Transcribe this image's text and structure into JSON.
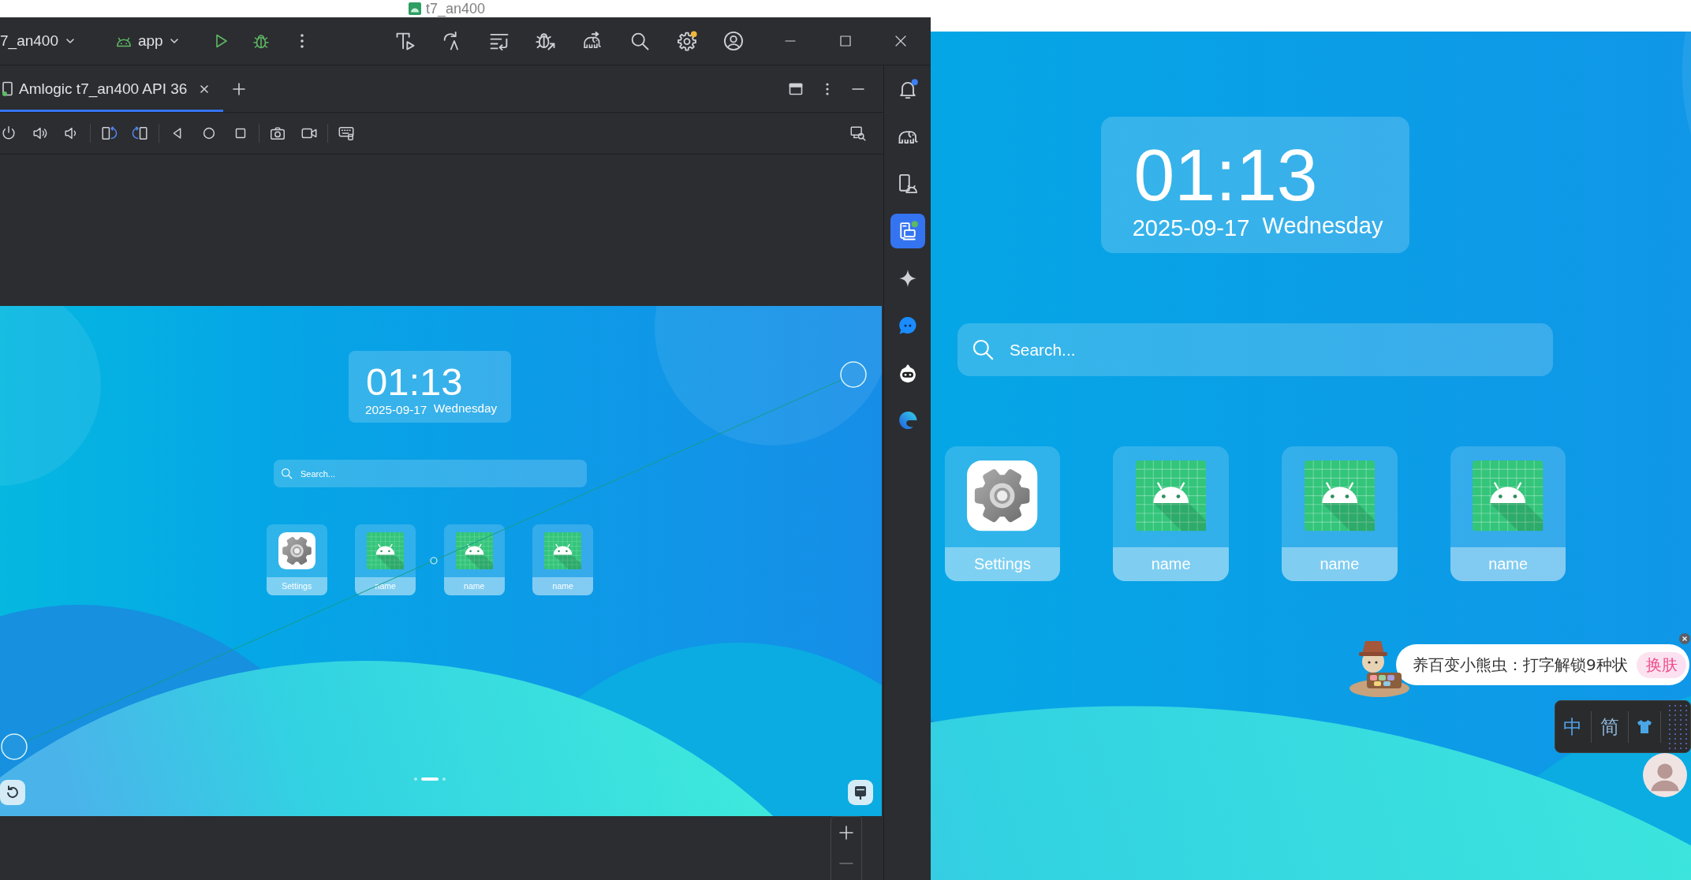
{
  "background_window": {
    "title": "t7_an400"
  },
  "ide": {
    "project": "7_an400",
    "run_configuration": "app",
    "tabs": [
      {
        "label": "Amlogic t7_an400 API 36",
        "selected": true
      }
    ],
    "sidebar": [
      {
        "kind": "bell",
        "selected": false
      },
      {
        "kind": "elephant",
        "selected": false
      },
      {
        "kind": "phone",
        "selected": false
      },
      {
        "kind": "mirror",
        "selected": true
      },
      {
        "kind": "sparkle",
        "selected": false
      },
      {
        "kind": "chat",
        "selected": false
      },
      {
        "kind": "robot",
        "selected": false
      },
      {
        "kind": "swirl",
        "selected": false
      }
    ]
  },
  "emulator_screen": {
    "clock": {
      "time": "01:13",
      "date": "2025-09-17",
      "weekday": "Wednesday"
    },
    "search": {
      "placeholder": "Search..."
    },
    "apps": [
      {
        "kind": "settings",
        "label": "Settings"
      },
      {
        "kind": "android",
        "label": "name"
      },
      {
        "kind": "android",
        "label": "name"
      },
      {
        "kind": "android",
        "label": "name"
      }
    ],
    "pages": [
      {
        "selected": false
      },
      {
        "selected": true
      },
      {
        "selected": false
      }
    ]
  },
  "device_screen": {
    "clock": {
      "time": "01:13",
      "date": "2025-09-17",
      "weekday": "Wednesday"
    },
    "search": {
      "placeholder": "Search..."
    },
    "apps": [
      {
        "kind": "settings",
        "label": "Settings"
      },
      {
        "kind": "android",
        "label": "name"
      },
      {
        "kind": "android",
        "label": "name"
      },
      {
        "kind": "android",
        "label": "name"
      }
    ]
  },
  "input_method": {
    "tip": "养百变小熊虫：打字解锁9种状",
    "skin_button": "换肤",
    "toolbar": [
      {
        "label": "中"
      },
      {
        "label": "简"
      }
    ]
  }
}
